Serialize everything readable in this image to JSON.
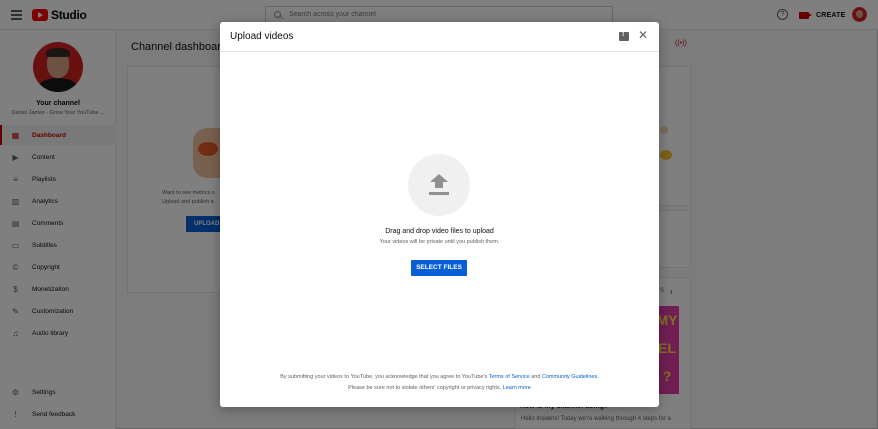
{
  "header": {
    "logo_text": "Studio",
    "search_placeholder": "Search across your channel",
    "help_glyph": "?",
    "create_label": "CREATE"
  },
  "sidebar": {
    "channel_title": "Your channel",
    "channel_subtitle": "Daniel James - Grow Your YouTube ...",
    "items": [
      {
        "label": "Dashboard",
        "icon": "dashboard-icon",
        "glyph": "▦",
        "active": true
      },
      {
        "label": "Content",
        "icon": "content-icon",
        "glyph": "▶",
        "active": false
      },
      {
        "label": "Playlists",
        "icon": "playlists-icon",
        "glyph": "≡",
        "active": false
      },
      {
        "label": "Analytics",
        "icon": "analytics-icon",
        "glyph": "▥",
        "active": false
      },
      {
        "label": "Comments",
        "icon": "comments-icon",
        "glyph": "▤",
        "active": false
      },
      {
        "label": "Subtitles",
        "icon": "subtitles-icon",
        "glyph": "▭",
        "active": false
      },
      {
        "label": "Copyright",
        "icon": "copyright-icon",
        "glyph": "©",
        "active": false
      },
      {
        "label": "Monetization",
        "icon": "monetization-icon",
        "glyph": "$",
        "active": false
      },
      {
        "label": "Customization",
        "icon": "customization-icon",
        "glyph": "✎",
        "active": false
      },
      {
        "label": "Audio library",
        "icon": "audio-library-icon",
        "glyph": "♫",
        "active": false
      }
    ],
    "settings_label": "Settings",
    "settings_glyph": "⚙",
    "feedback_label": "Send feedback",
    "feedback_glyph": "!"
  },
  "background": {
    "dashboard_title": "Channel dashboard",
    "card_text_1": "Want to see metrics o",
    "card_text_2": "Upload and publish a",
    "upload_button": "UPLOAD",
    "live_glyph": "((•))",
    "pager_text": "S",
    "pager_next": "›",
    "thumb_text": "MY EL ?",
    "article_title": "How is my channel doing?",
    "article_text": "Hello Insiders! Today we're walking through 4 steps for a"
  },
  "modal": {
    "title": "Upload videos",
    "close_glyph": "✕",
    "drag_title": "Drag and drop video files to upload",
    "drag_subtitle": "Your videos will be private until you publish them.",
    "select_button": "SELECT FILES",
    "footer_line1_prefix": "By submitting your videos to YouTube, you acknowledge that you agree to YouTube's ",
    "footer_link_terms": "Terms of Service",
    "footer_line1_and": " and ",
    "footer_link_guidelines": "Community Guidelines",
    "footer_line1_suffix": ".",
    "footer_line2_prefix": "Please be sure not to violate others' copyright or privacy rights. ",
    "footer_link_learn": "Learn more"
  },
  "colors": {
    "brand_red": "#ff0000",
    "active_red": "#cc0000",
    "primary_blue": "#065fd4"
  }
}
